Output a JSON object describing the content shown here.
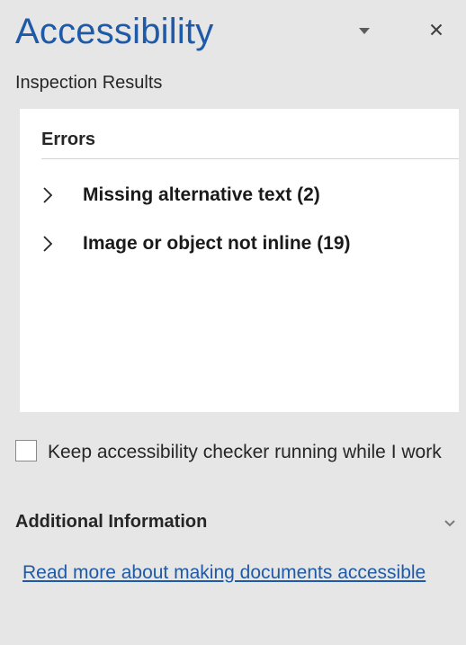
{
  "pane": {
    "title": "Accessibility",
    "options_icon": "chevron-down-icon",
    "close_icon": "close-icon",
    "subtitle": "Inspection Results"
  },
  "results": {
    "errors_heading": "Errors",
    "issues": [
      {
        "label": "Missing alternative text (2)",
        "icon": "chevron-right-icon",
        "expanded": false
      },
      {
        "label": "Image or object not inline (19)",
        "icon": "chevron-right-icon",
        "expanded": false
      }
    ]
  },
  "options": {
    "keep_running_checked": false,
    "keep_running_label": "Keep accessibility checker running while I work"
  },
  "additional_info": {
    "heading": "Additional Information",
    "toggle_icon": "chevron-down-icon",
    "link_text": "Read more about making documents accessible"
  },
  "colors": {
    "accent": "#1e5aa8",
    "pane_background": "#e6e6e6",
    "results_background": "#ffffff",
    "text": "#262626"
  }
}
